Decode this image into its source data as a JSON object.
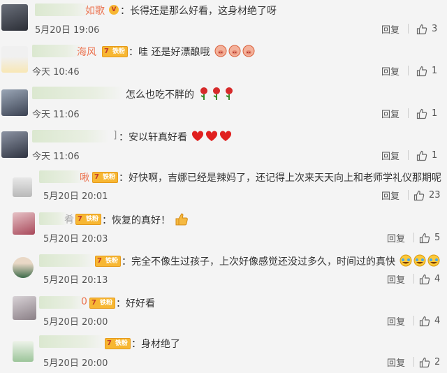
{
  "comments": [
    {
      "name": "如歌",
      "text": "：长得还是那么好看，这身材绝了呀",
      "time": "5月20日 19:06",
      "reply": "回复",
      "likes": "3"
    },
    {
      "name": "海风",
      "badge": "铁粉",
      "text": "：哇 还是好漂酿哦",
      "emoji": "pig-face x3",
      "time": "今天 10:46",
      "reply": "回复",
      "likes": "1"
    },
    {
      "text": "怎么也吃不胖的",
      "emoji": "rose x3",
      "time": "今天 11:06",
      "reply": "回复",
      "likes": "1"
    },
    {
      "name": "]",
      "text": "：安以轩真好看",
      "emoji": "heart x3",
      "time": "今天 11:06",
      "reply": "回复",
      "likes": "1"
    },
    {
      "name": "啾",
      "badge": "铁粉",
      "text": "：好快啊，吉娜已经是辣妈了，还记得上次来天天向上和老师学礼仪那期呢",
      "time": "5月20日 20:01",
      "reply": "回复",
      "likes": "23"
    },
    {
      "name": "肴",
      "badge": "铁粉",
      "text": "：恢复的真好！",
      "emoji": "thumbs-up",
      "time": "5月20日 20:03",
      "reply": "回复",
      "likes": "5"
    },
    {
      "badge": "铁粉",
      "text": "：完全不像生过孩子，上次好像感觉还没过多久，时间过的真快",
      "emoji": "crying-laugh x3",
      "time": "5月20日 20:13",
      "reply": "回复",
      "likes": "4"
    },
    {
      "name": "0",
      "badge": "铁粉",
      "text": "：好好看",
      "time": "5月20日 20:00",
      "reply": "回复",
      "likes": "4"
    },
    {
      "badge": "铁粉",
      "text": "：身材绝了",
      "time": "5月20日 20:00",
      "reply": "回复",
      "likes": "2"
    }
  ],
  "colors": {
    "name": "#eb7350",
    "badge": "#f7b733",
    "text": "#333333",
    "meta": "#555555",
    "background": "#f4f4f4"
  },
  "icons": {
    "like": "thumbs-up-outline-icon"
  }
}
